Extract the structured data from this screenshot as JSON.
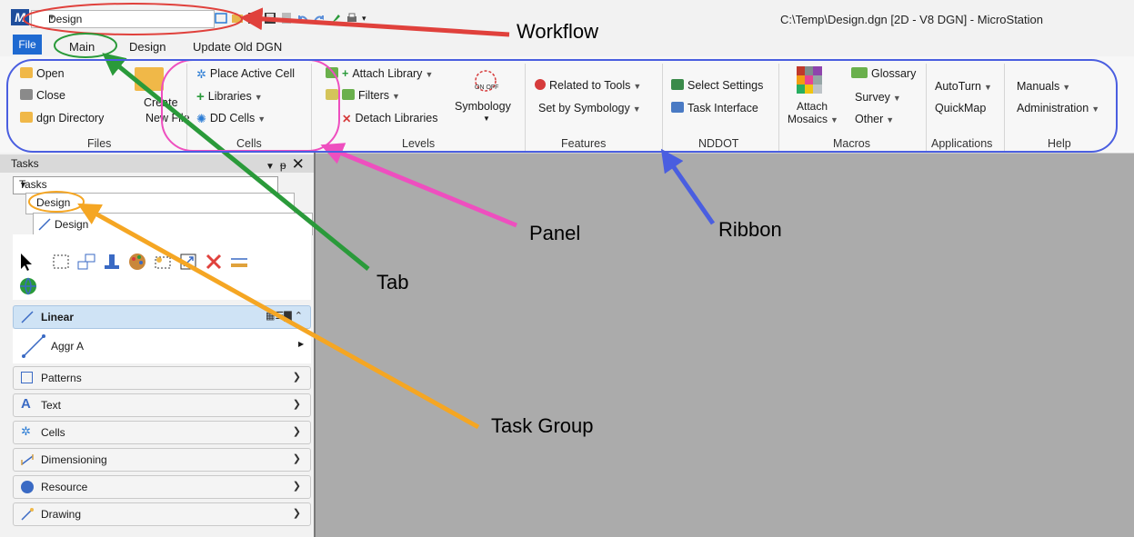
{
  "window": {
    "title": "C:\\Temp\\Design.dgn [2D - V8 DGN] - MicroStation",
    "workflow_value": "Design",
    "app_logo": "M"
  },
  "ribbon_tabs": {
    "file": "File",
    "main": "Main",
    "design": "Design",
    "update": "Update Old DGN"
  },
  "ribbon": {
    "files": {
      "open": "Open",
      "close": "Close",
      "dgn_directory": "dgn Directory",
      "create_new_file_line1": "Create",
      "create_new_file_line2": "New File",
      "title": "Files"
    },
    "cells": {
      "place_active_cell": "Place Active Cell",
      "libraries": "Libraries",
      "dd_cells": "DD Cells",
      "title": "Cells"
    },
    "levels": {
      "attach_library": "Attach Library",
      "filters": "Filters",
      "detach_libraries": "Detach Libraries",
      "symbology": "Symbology",
      "on_off": "ON OFF",
      "title": "Levels"
    },
    "features": {
      "related_to_tools": "Related to Tools",
      "set_by_symbology": "Set by Symbology",
      "title": "Features"
    },
    "nddot": {
      "select_settings": "Select Settings",
      "task_interface": "Task Interface",
      "title": "NDDOT"
    },
    "macros": {
      "attach_mosaics_line1": "Attach",
      "attach_mosaics_line2": "Mosaics",
      "glossary": "Glossary",
      "survey": "Survey",
      "other": "Other",
      "title": "Macros"
    },
    "applications": {
      "autoturn": "AutoTurn",
      "quickmap": "QuickMap",
      "title": "Applications"
    },
    "help": {
      "manuals": "Manuals",
      "administration": "Administration",
      "title": "Help"
    }
  },
  "tasks": {
    "header": "Tasks",
    "dropdown": "Tasks",
    "task_group": "Design",
    "subtab": "Design",
    "linear": "Linear",
    "aggr": "Aggr A",
    "groups": [
      "Patterns",
      "Text",
      "Cells",
      "Dimensioning",
      "Resource",
      "Drawing"
    ]
  },
  "annotations": {
    "workflow": "Workflow",
    "panel": "Panel",
    "ribbon": "Ribbon",
    "tab": "Tab",
    "task_group": "Task Group"
  },
  "colors": {
    "annot_red": "#e0413c",
    "annot_green": "#2a9a3a",
    "annot_magenta": "#ee4fbf",
    "annot_blue": "#4a5ee0",
    "annot_orange": "#f5a623",
    "file_tab": "#1f6ad1"
  }
}
